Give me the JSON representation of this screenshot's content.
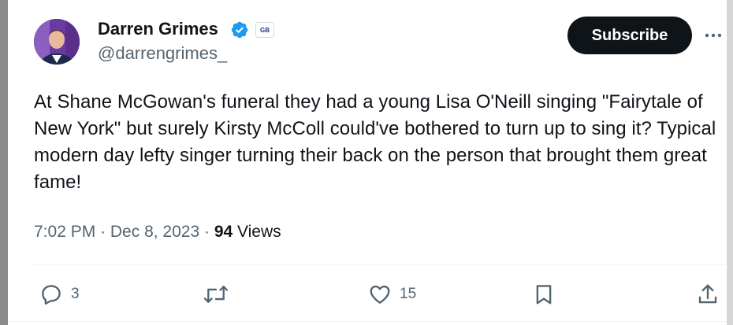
{
  "author": {
    "display_name": "Darren Grimes",
    "handle": "@darrengrimes_",
    "org_badge_label": "GB",
    "verified_color": "#1d9bf0"
  },
  "header": {
    "subscribe_label": "Subscribe"
  },
  "tweet": {
    "text": "At Shane McGowan's funeral they had a young Lisa O'Neill singing \"Fairytale of New York\" but surely Kirsty McColl could've bothered to turn up to sing it? Typical modern day lefty singer turning their back on the person that brought them great fame!",
    "time": "7:02 PM",
    "date": "Dec 8, 2023",
    "views_count": "94",
    "views_label": "Views"
  },
  "actions": {
    "reply_count": "3",
    "like_count": "15",
    "icons": [
      "reply-icon",
      "retweet-icon",
      "like-icon",
      "bookmark-icon",
      "share-icon"
    ]
  },
  "colors": {
    "text": "#0f1419",
    "secondary": "#536471",
    "button_bg": "#0f1419"
  }
}
